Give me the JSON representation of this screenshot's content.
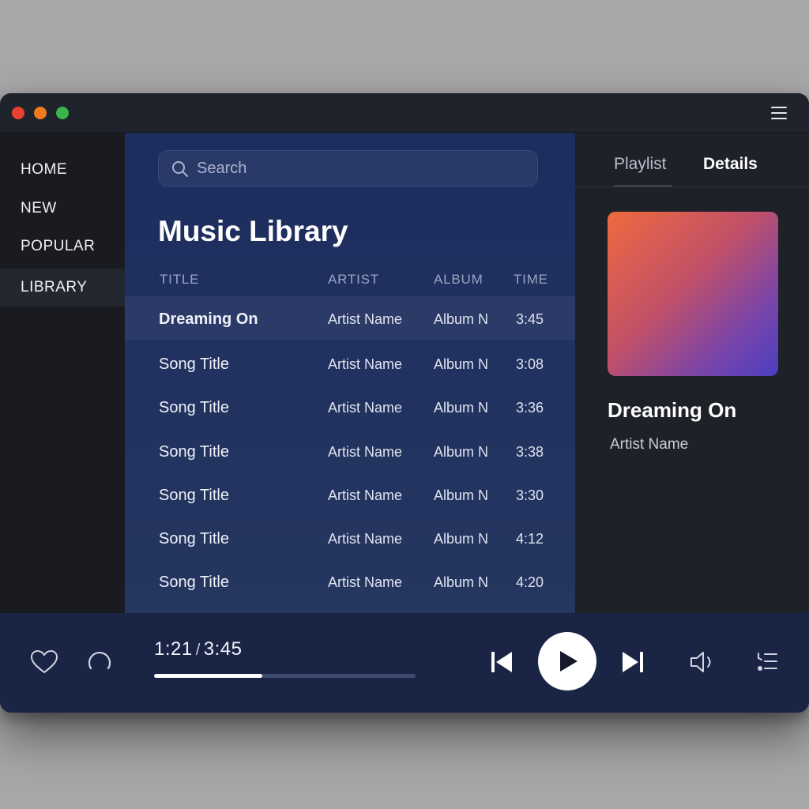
{
  "nav": {
    "items": [
      {
        "label": "HOME"
      },
      {
        "label": "NEW"
      },
      {
        "label": "POPULAR"
      },
      {
        "label": "LIBRARY",
        "active": true
      }
    ]
  },
  "search": {
    "placeholder": "Search",
    "value": ""
  },
  "library": {
    "title": "Music Library",
    "columns": [
      "TITLE",
      "ARTIST",
      "ALBUM",
      "TIME"
    ],
    "rows": [
      {
        "title": "Dreaming On",
        "artist": "Artist Name",
        "album": "Album N",
        "time": "3:45",
        "selected": true
      },
      {
        "title": "Song Title",
        "artist": "Artist Name",
        "album": "Album N",
        "time": "3:08"
      },
      {
        "title": "Song Title",
        "artist": "Artist Name",
        "album": "Album N",
        "time": "3:36"
      },
      {
        "title": "Song Title",
        "artist": "Artist Name",
        "album": "Album N",
        "time": "3:38"
      },
      {
        "title": "Song Title",
        "artist": "Artist Name",
        "album": "Album N",
        "time": "3:30"
      },
      {
        "title": "Song Title",
        "artist": "Artist Name",
        "album": "Album N",
        "time": "4:12"
      },
      {
        "title": "Song Title",
        "artist": "Artist Name",
        "album": "Album N",
        "time": "4:20"
      }
    ]
  },
  "panel": {
    "tabs": [
      {
        "label": "Playlist"
      },
      {
        "label": "Details",
        "active": true
      }
    ],
    "now_playing": {
      "title": "Dreaming On",
      "artist": "Artist Name"
    }
  },
  "player": {
    "current_time": "1:21",
    "separator": "/",
    "total_time": "3:45",
    "progress": 0.415
  },
  "icons": {
    "window_menu": "hamburger-menu-icon",
    "search": "search-icon",
    "like": "heart-icon",
    "repeat": "repeat-icon",
    "previous": "skip-previous-icon",
    "play": "play-icon",
    "next": "skip-next-icon",
    "volume": "volume-icon",
    "queue": "queue-icon"
  },
  "colors": {
    "window_red": "#e8412f",
    "window_orange": "#f07b1f",
    "window_green": "#39b54a",
    "accent_art_start": "#ef6a3c",
    "accent_art_end": "#4b3fc0"
  }
}
